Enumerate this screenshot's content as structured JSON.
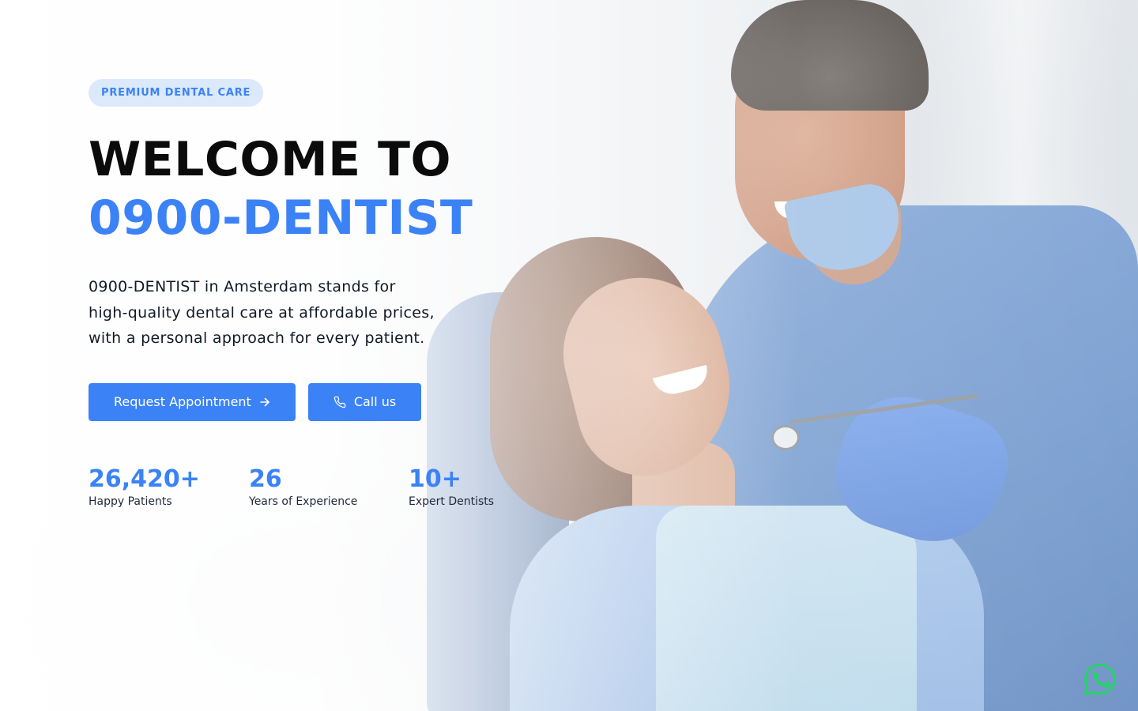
{
  "hero": {
    "badge": "PREMIUM DENTAL CARE",
    "title_line1": "WELCOME TO",
    "title_line2": "0900-DENTIST",
    "description": "0900-DENTIST in Amsterdam stands for high-quality dental care at affordable prices, with a personal approach for every patient.",
    "primary_button": {
      "label": "Request Appointment",
      "icon": "arrow-right-icon"
    },
    "secondary_button": {
      "label": "Call us",
      "icon": "phone-icon"
    },
    "background_image": "dentist-with-smiling-patient-photo"
  },
  "stats": [
    {
      "value": "26,420+",
      "label": "Happy Patients"
    },
    {
      "value": "26",
      "label": "Years of Experience"
    },
    {
      "value": "10+",
      "label": "Expert Dentists"
    }
  ],
  "floating": {
    "whatsapp_icon": "whatsapp-icon"
  },
  "colors": {
    "accent": "#3b82f6",
    "badge_bg": "#dce9fb",
    "heading": "#0b0b0b",
    "whatsapp": "#25d366"
  }
}
